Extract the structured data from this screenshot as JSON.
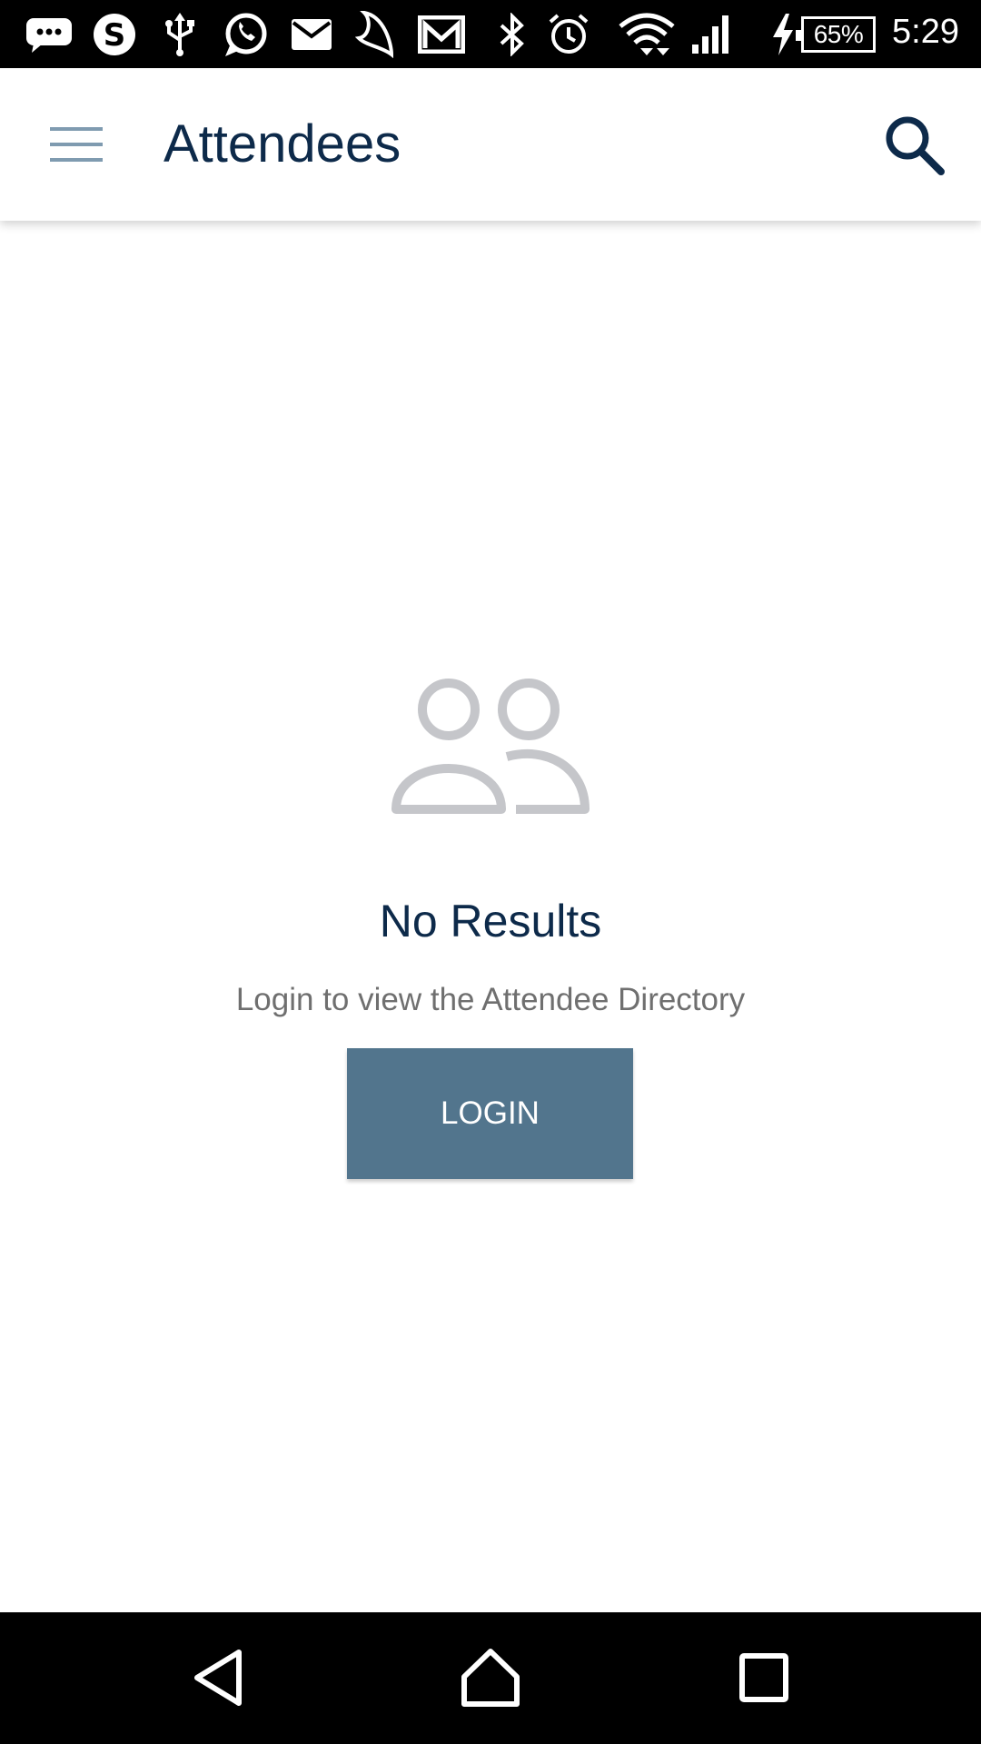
{
  "status_bar": {
    "battery_percent": "65%",
    "time": "5:29",
    "icons": [
      "messages-icon",
      "skype-icon",
      "usb-icon",
      "whatsapp-icon",
      "email-icon",
      "moon-icon",
      "gmail-icon",
      "bluetooth-icon",
      "alarm-icon",
      "wifi-icon",
      "cell-signal-icon",
      "charging-icon",
      "battery-icon"
    ]
  },
  "app_bar": {
    "title": "Attendees",
    "menu_icon": "hamburger-menu-icon",
    "search_icon": "search-icon"
  },
  "empty_state": {
    "icon": "people-icon",
    "title": "No Results",
    "subtitle": "Login to view the Attendee Directory",
    "button_label": "LOGIN"
  },
  "nav_bar": {
    "icons": [
      "back-icon",
      "home-icon",
      "recents-icon"
    ]
  },
  "colors": {
    "title_text": "#0d2a4a",
    "accent_button": "#52758d",
    "menu_icon": "#7f9bb0",
    "empty_icon": "#c5c6ca",
    "subtitle_text": "#6f6f6f"
  }
}
